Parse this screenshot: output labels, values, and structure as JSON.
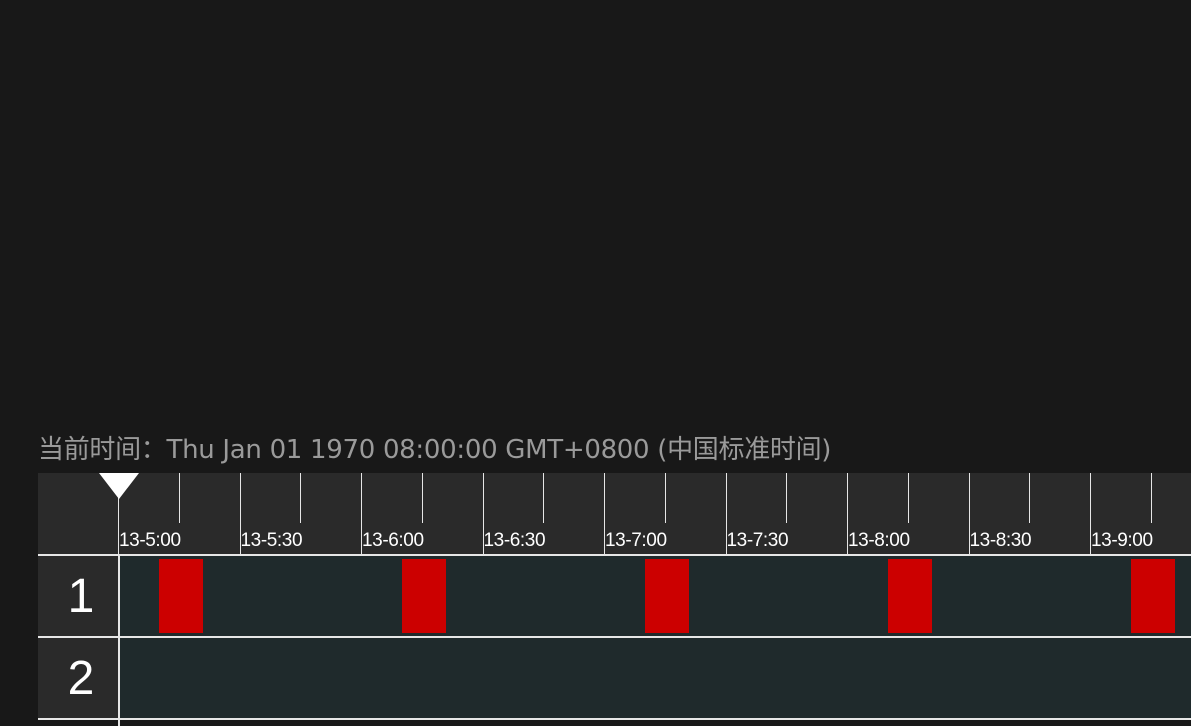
{
  "current_time": {
    "label": "当前时间：",
    "value": "Thu Jan 01 1970 08:00:00 GMT+0800 (中国标准时间)"
  },
  "timeline": {
    "tick_labels": [
      "13-5:00",
      "13-5:30",
      "13-6:00",
      "13-6:30",
      "13-7:00",
      "13-7:30",
      "13-8:00",
      "13-8:30",
      "13-9:00"
    ],
    "tracks": [
      {
        "label": "1",
        "segments": [
          "13-5:10",
          "13-6:10",
          "13-7:10",
          "13-8:10",
          "13-9:10"
        ]
      },
      {
        "label": "2",
        "segments": []
      }
    ],
    "segment_color": "#cc0000",
    "lane_color": "#1f2a2c",
    "header_color": "#2a2a2a"
  }
}
